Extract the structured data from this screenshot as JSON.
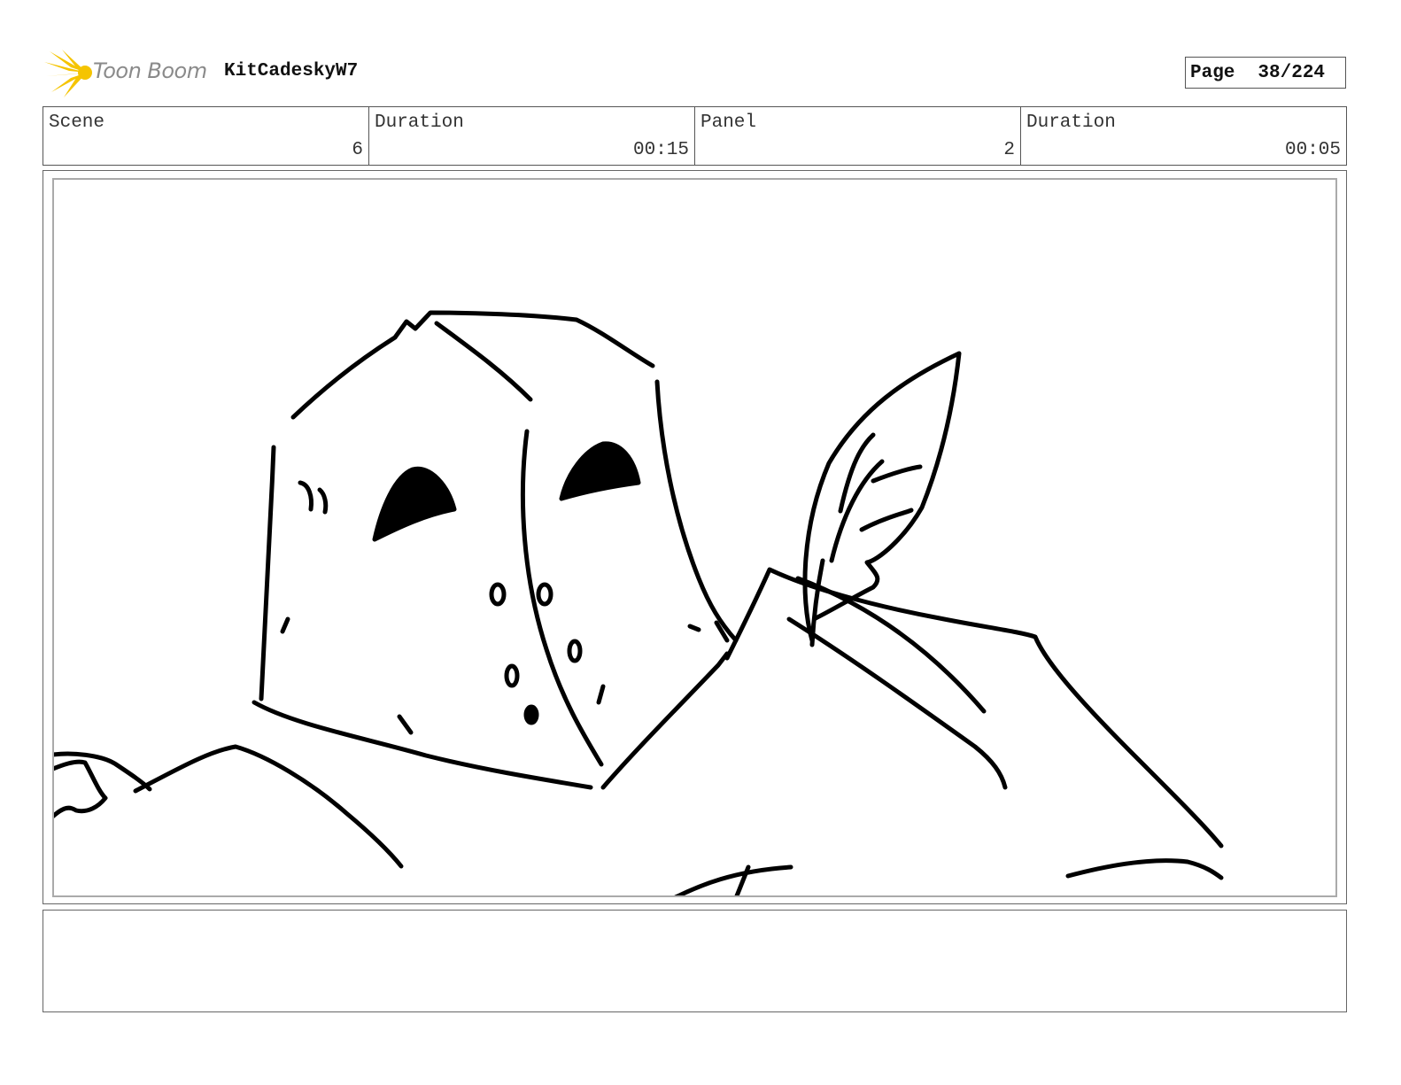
{
  "brand": {
    "name": "Toon Boom",
    "accent": "#f5c400"
  },
  "project": {
    "title": "KitCadeskyW7"
  },
  "page": {
    "label": "Page",
    "value": "38/224"
  },
  "header": {
    "cells": [
      {
        "label": "Scene",
        "value": "6"
      },
      {
        "label": "Duration",
        "value": "00:15"
      },
      {
        "label": "Panel",
        "value": "2"
      },
      {
        "label": "Duration",
        "value": "00:05"
      }
    ]
  },
  "panel": {
    "image": "storyboard-sketch"
  },
  "notes": {
    "text": ""
  }
}
